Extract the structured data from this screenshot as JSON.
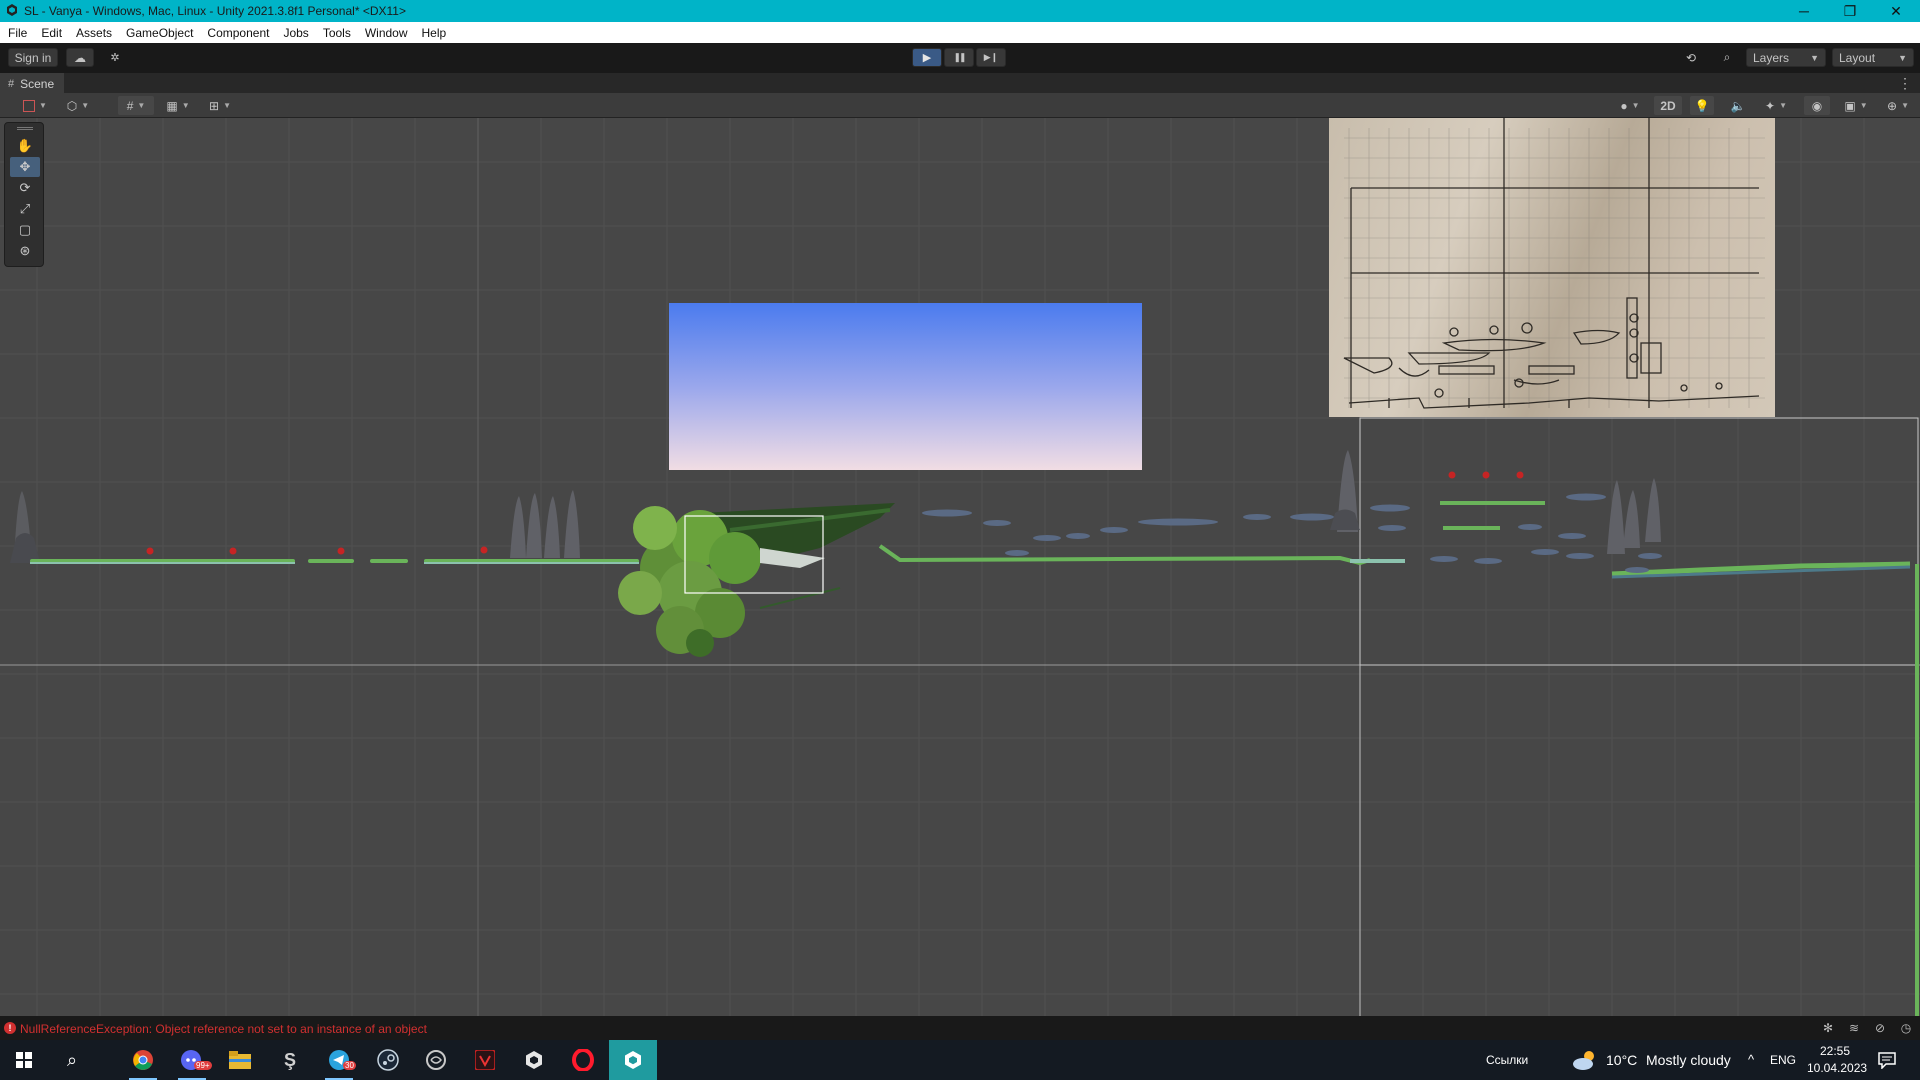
{
  "window": {
    "title": "SL - Vanya - Windows, Mac, Linux - Unity 2021.3.8f1 Personal* <DX11>",
    "minimize_glyph": "─",
    "restore_glyph": "❐",
    "close_glyph": "✕"
  },
  "menu": [
    "File",
    "Edit",
    "Assets",
    "GameObject",
    "Component",
    "Jobs",
    "Tools",
    "Window",
    "Help"
  ],
  "toolbar": {
    "sign_in": "Sign in",
    "layers": "Layers",
    "layout": "Layout",
    "play_glyph": "▶",
    "pause_glyph": "❚❚",
    "step_glyph": "▶❙"
  },
  "scene_tab": {
    "label": "Scene"
  },
  "scene_toolbar": {
    "mode_2d": "2D"
  },
  "console": {
    "error": "NullReferenceException: Object reference not set to an instance of an object"
  },
  "taskbar": {
    "telegram_badge": "30",
    "discord_badge": "99+",
    "links_label": "Ссылки",
    "weather_temp": "10°C",
    "weather_desc": "Mostly cloudy",
    "tray_arrow": "^",
    "language": "ENG",
    "time": "22:55",
    "date": "10.04.2023"
  },
  "colors": {
    "titlebar": "#00b4c8",
    "scene_bg": "#474747",
    "error_red": "#d13030",
    "play_blue": "#3a5a86",
    "taskbar_bg": "#141a22",
    "active_task": "#1f9b9f"
  }
}
